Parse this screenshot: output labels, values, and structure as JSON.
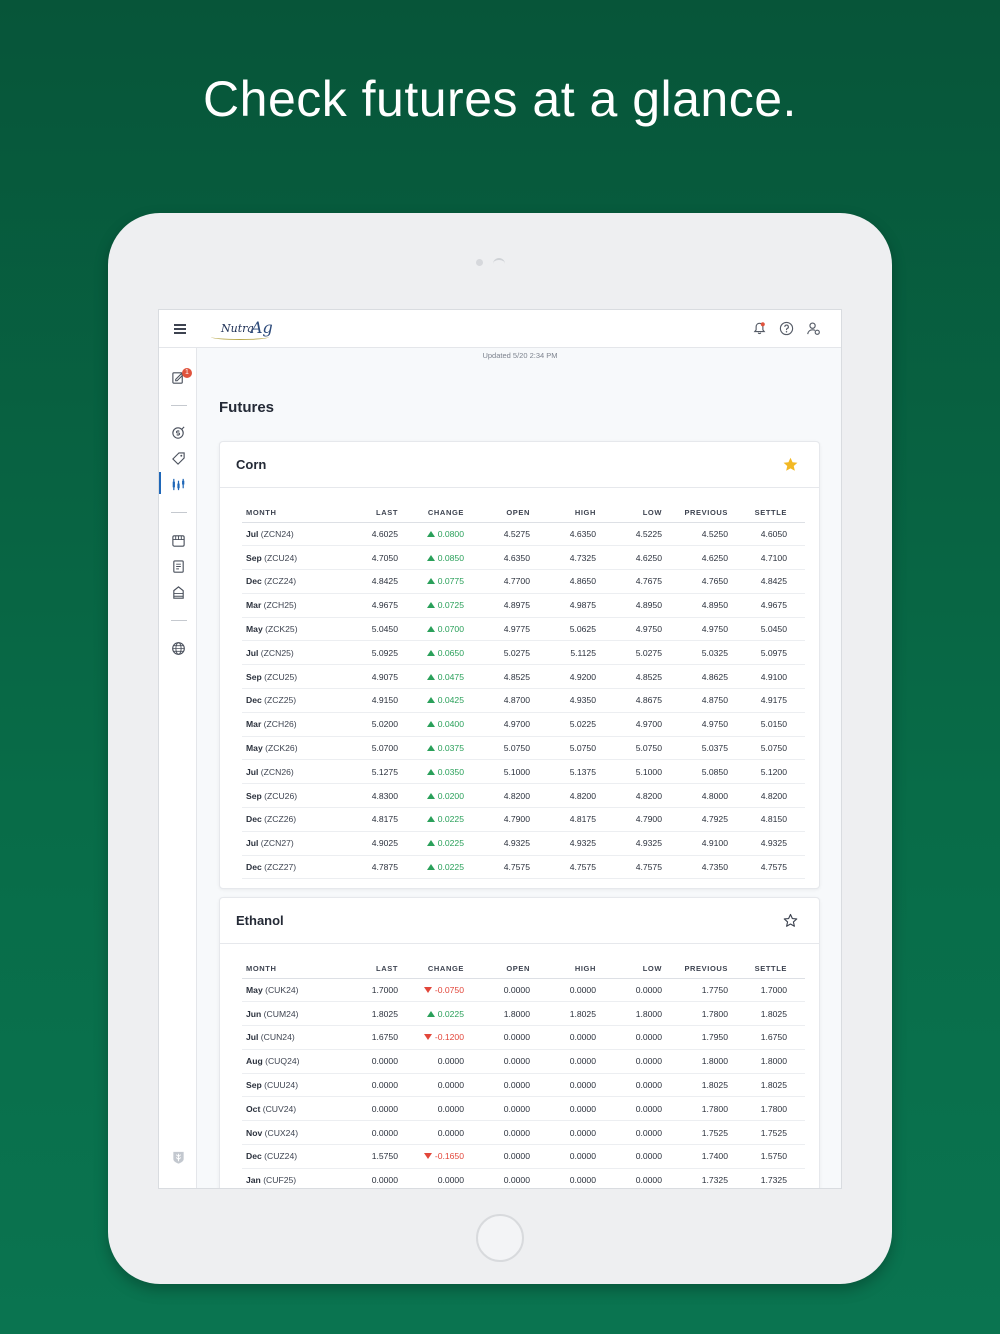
{
  "headline": "Check futures at a glance.",
  "app": {
    "logo_text": "Nutra",
    "logo_ag": "Ag",
    "notification_badge": "1",
    "updated": "Updated 5/20 2:34 PM",
    "page_title": "Futures"
  },
  "colors": {
    "up": "#2aa05a",
    "down": "#e2463a",
    "accent": "#1f67b8",
    "star": "#f2b824"
  },
  "columns": [
    "MONTH",
    "LAST",
    "CHANGE",
    "OPEN",
    "HIGH",
    "LOW",
    "PREVIOUS",
    "SETTLE"
  ],
  "corn": {
    "title": "Corn",
    "favorite": true,
    "rows": [
      {
        "month": "Jul",
        "code": "(ZCN24)",
        "last": "4.6025",
        "change": "0.0800",
        "dir": "up",
        "open": "4.5275",
        "high": "4.6350",
        "low": "4.5225",
        "previous": "4.5250",
        "settle": "4.6050"
      },
      {
        "month": "Sep",
        "code": "(ZCU24)",
        "last": "4.7050",
        "change": "0.0850",
        "dir": "up",
        "open": "4.6350",
        "high": "4.7325",
        "low": "4.6250",
        "previous": "4.6250",
        "settle": "4.7100"
      },
      {
        "month": "Dec",
        "code": "(ZCZ24)",
        "last": "4.8425",
        "change": "0.0775",
        "dir": "up",
        "open": "4.7700",
        "high": "4.8650",
        "low": "4.7675",
        "previous": "4.7650",
        "settle": "4.8425"
      },
      {
        "month": "Mar",
        "code": "(ZCH25)",
        "last": "4.9675",
        "change": "0.0725",
        "dir": "up",
        "open": "4.8975",
        "high": "4.9875",
        "low": "4.8950",
        "previous": "4.8950",
        "settle": "4.9675"
      },
      {
        "month": "May",
        "code": "(ZCK25)",
        "last": "5.0450",
        "change": "0.0700",
        "dir": "up",
        "open": "4.9775",
        "high": "5.0625",
        "low": "4.9750",
        "previous": "4.9750",
        "settle": "5.0450"
      },
      {
        "month": "Jul",
        "code": "(ZCN25)",
        "last": "5.0925",
        "change": "0.0650",
        "dir": "up",
        "open": "5.0275",
        "high": "5.1125",
        "low": "5.0275",
        "previous": "5.0325",
        "settle": "5.0975"
      },
      {
        "month": "Sep",
        "code": "(ZCU25)",
        "last": "4.9075",
        "change": "0.0475",
        "dir": "up",
        "open": "4.8525",
        "high": "4.9200",
        "low": "4.8525",
        "previous": "4.8625",
        "settle": "4.9100"
      },
      {
        "month": "Dec",
        "code": "(ZCZ25)",
        "last": "4.9150",
        "change": "0.0425",
        "dir": "up",
        "open": "4.8700",
        "high": "4.9350",
        "low": "4.8675",
        "previous": "4.8750",
        "settle": "4.9175"
      },
      {
        "month": "Mar",
        "code": "(ZCH26)",
        "last": "5.0200",
        "change": "0.0400",
        "dir": "up",
        "open": "4.9700",
        "high": "5.0225",
        "low": "4.9700",
        "previous": "4.9750",
        "settle": "5.0150"
      },
      {
        "month": "May",
        "code": "(ZCK26)",
        "last": "5.0700",
        "change": "0.0375",
        "dir": "up",
        "open": "5.0750",
        "high": "5.0750",
        "low": "5.0750",
        "previous": "5.0375",
        "settle": "5.0750"
      },
      {
        "month": "Jul",
        "code": "(ZCN26)",
        "last": "5.1275",
        "change": "0.0350",
        "dir": "up",
        "open": "5.1000",
        "high": "5.1375",
        "low": "5.1000",
        "previous": "5.0850",
        "settle": "5.1200"
      },
      {
        "month": "Sep",
        "code": "(ZCU26)",
        "last": "4.8300",
        "change": "0.0200",
        "dir": "up",
        "open": "4.8200",
        "high": "4.8200",
        "low": "4.8200",
        "previous": "4.8000",
        "settle": "4.8200"
      },
      {
        "month": "Dec",
        "code": "(ZCZ26)",
        "last": "4.8175",
        "change": "0.0225",
        "dir": "up",
        "open": "4.7900",
        "high": "4.8175",
        "low": "4.7900",
        "previous": "4.7925",
        "settle": "4.8150"
      },
      {
        "month": "Jul",
        "code": "(ZCN27)",
        "last": "4.9025",
        "change": "0.0225",
        "dir": "up",
        "open": "4.9325",
        "high": "4.9325",
        "low": "4.9325",
        "previous": "4.9100",
        "settle": "4.9325"
      },
      {
        "month": "Dec",
        "code": "(ZCZ27)",
        "last": "4.7875",
        "change": "0.0225",
        "dir": "up",
        "open": "4.7575",
        "high": "4.7575",
        "low": "4.7575",
        "previous": "4.7350",
        "settle": "4.7575"
      }
    ]
  },
  "ethanol": {
    "title": "Ethanol",
    "favorite": false,
    "rows": [
      {
        "month": "May",
        "code": "(CUK24)",
        "last": "1.7000",
        "change": "-0.0750",
        "dir": "down",
        "open": "0.0000",
        "high": "0.0000",
        "low": "0.0000",
        "previous": "1.7750",
        "settle": "1.7000"
      },
      {
        "month": "Jun",
        "code": "(CUM24)",
        "last": "1.8025",
        "change": "0.0225",
        "dir": "up",
        "open": "1.8000",
        "high": "1.8025",
        "low": "1.8000",
        "previous": "1.7800",
        "settle": "1.8025"
      },
      {
        "month": "Jul",
        "code": "(CUN24)",
        "last": "1.6750",
        "change": "-0.1200",
        "dir": "down",
        "open": "0.0000",
        "high": "0.0000",
        "low": "0.0000",
        "previous": "1.7950",
        "settle": "1.6750"
      },
      {
        "month": "Aug",
        "code": "(CUQ24)",
        "last": "0.0000",
        "change": "0.0000",
        "dir": "none",
        "open": "0.0000",
        "high": "0.0000",
        "low": "0.0000",
        "previous": "1.8000",
        "settle": "1.8000"
      },
      {
        "month": "Sep",
        "code": "(CUU24)",
        "last": "0.0000",
        "change": "0.0000",
        "dir": "none",
        "open": "0.0000",
        "high": "0.0000",
        "low": "0.0000",
        "previous": "1.8025",
        "settle": "1.8025"
      },
      {
        "month": "Oct",
        "code": "(CUV24)",
        "last": "0.0000",
        "change": "0.0000",
        "dir": "none",
        "open": "0.0000",
        "high": "0.0000",
        "low": "0.0000",
        "previous": "1.7800",
        "settle": "1.7800"
      },
      {
        "month": "Nov",
        "code": "(CUX24)",
        "last": "0.0000",
        "change": "0.0000",
        "dir": "none",
        "open": "0.0000",
        "high": "0.0000",
        "low": "0.0000",
        "previous": "1.7525",
        "settle": "1.7525"
      },
      {
        "month": "Dec",
        "code": "(CUZ24)",
        "last": "1.5750",
        "change": "-0.1650",
        "dir": "down",
        "open": "0.0000",
        "high": "0.0000",
        "low": "0.0000",
        "previous": "1.7400",
        "settle": "1.5750"
      },
      {
        "month": "Jan",
        "code": "(CUF25)",
        "last": "0.0000",
        "change": "0.0000",
        "dir": "none",
        "open": "0.0000",
        "high": "0.0000",
        "low": "0.0000",
        "previous": "1.7325",
        "settle": "1.7325"
      }
    ]
  }
}
